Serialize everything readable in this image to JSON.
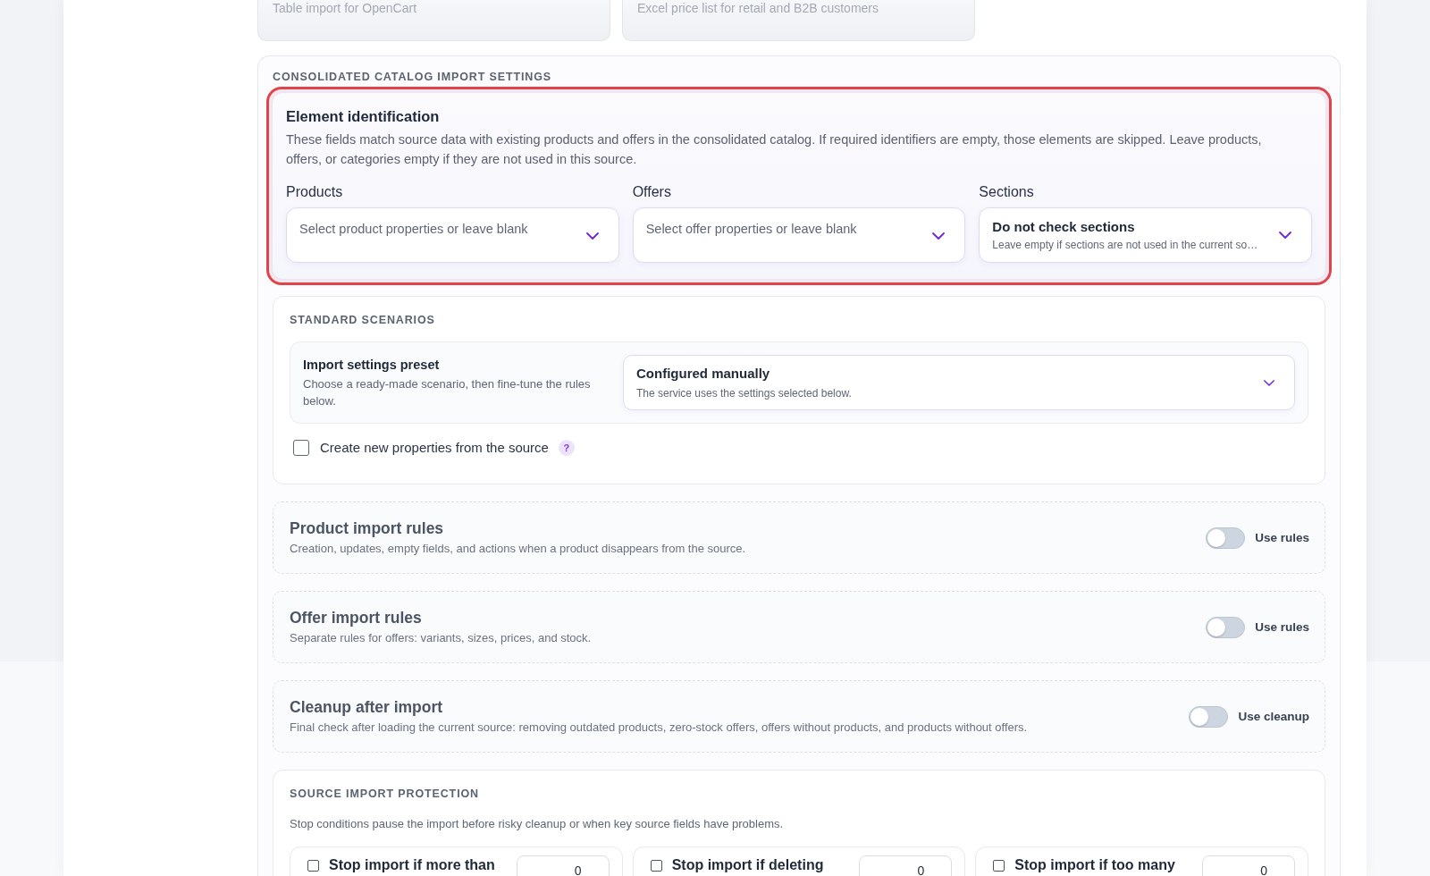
{
  "source_cards": [
    {
      "description": "Table import for OpenCart"
    },
    {
      "description": "Excel price list for retail and B2B customers"
    }
  ],
  "catalog_settings": {
    "heading": "CONSOLIDATED CATALOG IMPORT SETTINGS",
    "identification": {
      "highlighted": true,
      "title": "Element identification",
      "description": "These fields match source data with existing products and offers in the consolidated catalog. If required identifiers are empty, those elements are skipped. Leave products, offers, or categories empty if they are not used in this source.",
      "fields": [
        {
          "label": "Products",
          "placeholder": "Select product properties or leave blank"
        },
        {
          "label": "Offers",
          "placeholder": "Select offer properties or leave blank"
        },
        {
          "label": "Sections",
          "value": "Do not check sections",
          "hint": "Leave empty if sections are not used in the current so…"
        }
      ]
    },
    "standard_scenarios": {
      "heading": "STANDARD SCENARIOS",
      "preset": {
        "title": "Import settings preset",
        "description": "Choose a ready-made scenario, then fine-tune the rules below.",
        "value": "Configured manually",
        "hint": "The service uses the settings selected below."
      },
      "create_properties": {
        "label": "Create new properties from the source",
        "checked": false,
        "help": "?"
      }
    },
    "rule_sections": [
      {
        "title": "Product import rules",
        "description": "Creation, updates, empty fields, and actions when a product disappears from the source.",
        "toggle_label": "Use rules",
        "on": false
      },
      {
        "title": "Offer import rules",
        "description": "Separate rules for offers: variants, sizes, prices, and stock.",
        "toggle_label": "Use rules",
        "on": false
      },
      {
        "title": "Cleanup after import",
        "description": "Final check after loading the current source: removing outdated products, zero-stock offers, offers without products, and products without offers.",
        "toggle_label": "Use cleanup",
        "on": false
      }
    ],
    "protection": {
      "heading": "SOURCE IMPORT PROTECTION",
      "description": "Stop conditions pause the import before risky cleanup or when key source fields have problems.",
      "conditions": [
        {
          "label": "Stop import if more than",
          "checked": false,
          "value": "0"
        },
        {
          "label": "Stop import if deleting",
          "checked": false,
          "value": "0"
        },
        {
          "label": "Stop import if too many",
          "checked": false,
          "value": "0"
        }
      ]
    }
  }
}
